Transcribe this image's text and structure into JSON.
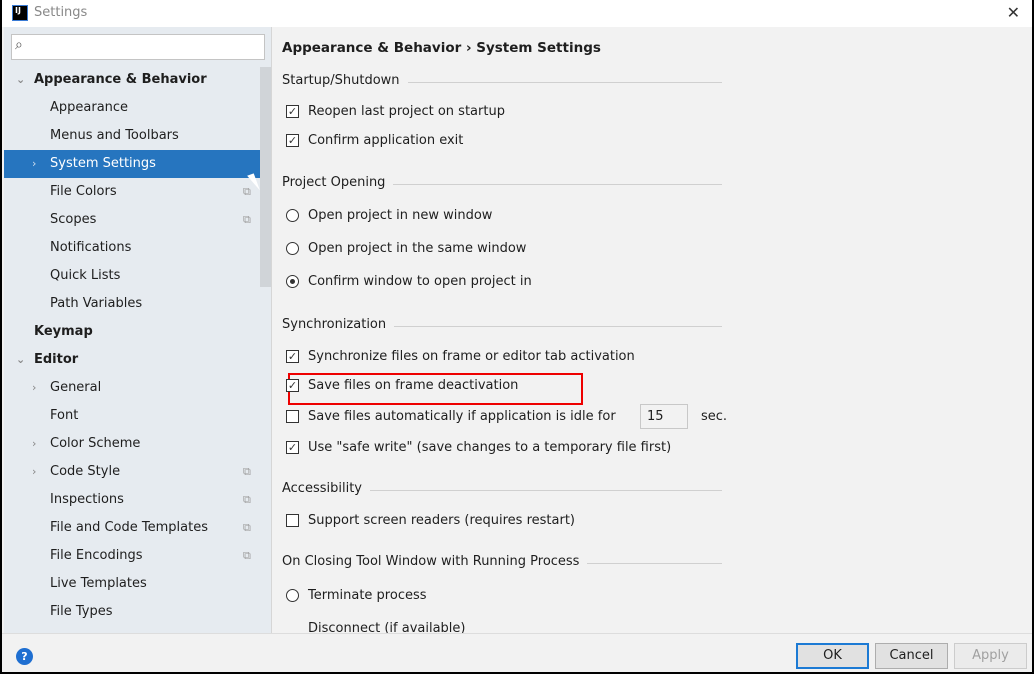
{
  "window": {
    "title": "Settings",
    "logo": "IJ",
    "close": "✕"
  },
  "sidebar": {
    "search_placeholder": "",
    "items": [
      {
        "label": "Appearance & Behavior",
        "level": 0,
        "arrow": "⌄",
        "bold": true
      },
      {
        "label": "Appearance",
        "level": 1
      },
      {
        "label": "Menus and Toolbars",
        "level": 1
      },
      {
        "label": "System Settings",
        "level": 1,
        "arrow": "›",
        "selected": true
      },
      {
        "label": "File Colors",
        "level": 1,
        "copy": true
      },
      {
        "label": "Scopes",
        "level": 1,
        "copy": true
      },
      {
        "label": "Notifications",
        "level": 1
      },
      {
        "label": "Quick Lists",
        "level": 1
      },
      {
        "label": "Path Variables",
        "level": 1
      },
      {
        "label": "Keymap",
        "level": 0,
        "bold": true
      },
      {
        "label": "Editor",
        "level": 0,
        "arrow": "⌄",
        "bold": true
      },
      {
        "label": "General",
        "level": 1,
        "arrow": "›"
      },
      {
        "label": "Font",
        "level": 1
      },
      {
        "label": "Color Scheme",
        "level": 1,
        "arrow": "›"
      },
      {
        "label": "Code Style",
        "level": 1,
        "arrow": "›",
        "copy": true
      },
      {
        "label": "Inspections",
        "level": 1,
        "copy": true
      },
      {
        "label": "File and Code Templates",
        "level": 1,
        "copy": true
      },
      {
        "label": "File Encodings",
        "level": 1,
        "copy": true
      },
      {
        "label": "Live Templates",
        "level": 1
      },
      {
        "label": "File Types",
        "level": 1
      }
    ]
  },
  "main": {
    "breadcrumb": "Appearance & Behavior › System Settings",
    "sections": {
      "startup": "Startup/Shutdown",
      "opening": "Project Opening",
      "sync": "Synchronization",
      "access": "Accessibility",
      "closing": "On Closing Tool Window with Running Process"
    },
    "options": {
      "reopen": {
        "label": "Reopen last project on startup",
        "checked": true
      },
      "confirm_exit": {
        "label": "Confirm application exit",
        "checked": true
      },
      "new_window": {
        "label": "Open project in new window",
        "selected": false
      },
      "same_window": {
        "label": "Open project in the same window",
        "selected": false
      },
      "confirm_window": {
        "label": "Confirm window to open project in",
        "selected": true
      },
      "sync_files": {
        "label": "Synchronize files on frame or editor tab activation",
        "checked": true
      },
      "save_deact": {
        "label": "Save files on frame deactivation",
        "checked": true
      },
      "save_idle": {
        "label": "Save files automatically if application is idle for",
        "checked": false,
        "value": "15",
        "unit": "sec."
      },
      "safe_write": {
        "label": "Use \"safe write\" (save changes to a temporary file first)",
        "checked": true
      },
      "screen_readers": {
        "label": "Support screen readers (requires restart)",
        "checked": false
      },
      "terminate": {
        "label": "Terminate process",
        "selected": false
      },
      "disconnect": {
        "label": "Disconnect (if available)",
        "selected": false
      }
    }
  },
  "footer": {
    "help": "?",
    "ok": "OK",
    "cancel": "Cancel",
    "apply": "Apply"
  },
  "colors": {
    "selection": "#2675bf",
    "highlight": "#e00000",
    "ok_border": "#1c7ad4"
  }
}
